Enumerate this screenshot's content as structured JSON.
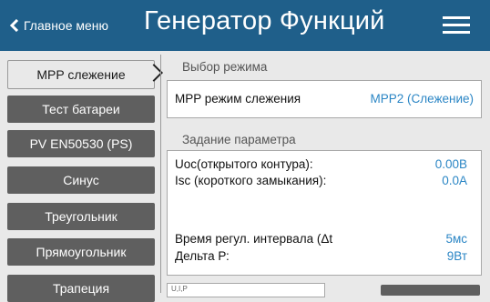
{
  "header": {
    "back_label": "Главное меню",
    "title": "Генератор Функций"
  },
  "sidebar": {
    "items": [
      {
        "label": "MPP слежение",
        "active": true
      },
      {
        "label": "Тест батареи"
      },
      {
        "label": "PV EN50530 (PS)"
      },
      {
        "label": "Синус"
      },
      {
        "label": "Треугольник"
      },
      {
        "label": "Прямоугольник"
      },
      {
        "label": "Трапеция"
      }
    ]
  },
  "mode": {
    "section_label": "Выбор режима",
    "label": "MPP режим слежения",
    "value": "MPP2 (Слежение)"
  },
  "params": {
    "section_label": "Задание параметра",
    "rows": [
      {
        "label": "Uoc(открытого контура):",
        "value": "0.00В"
      },
      {
        "label": "Isc (короткого замыкания):",
        "value": "0.0A"
      },
      {
        "label": "Время регул. интервала (Δt",
        "value": "5мс"
      },
      {
        "label": "Дельта Р:",
        "value": "9Вт"
      }
    ]
  },
  "bottom": {
    "input_text": "U,I,P"
  },
  "colors": {
    "header_bg": "#1f5f8a",
    "value_color": "#2b86c5",
    "sidebar_item_bg": "#5f5f5f"
  }
}
